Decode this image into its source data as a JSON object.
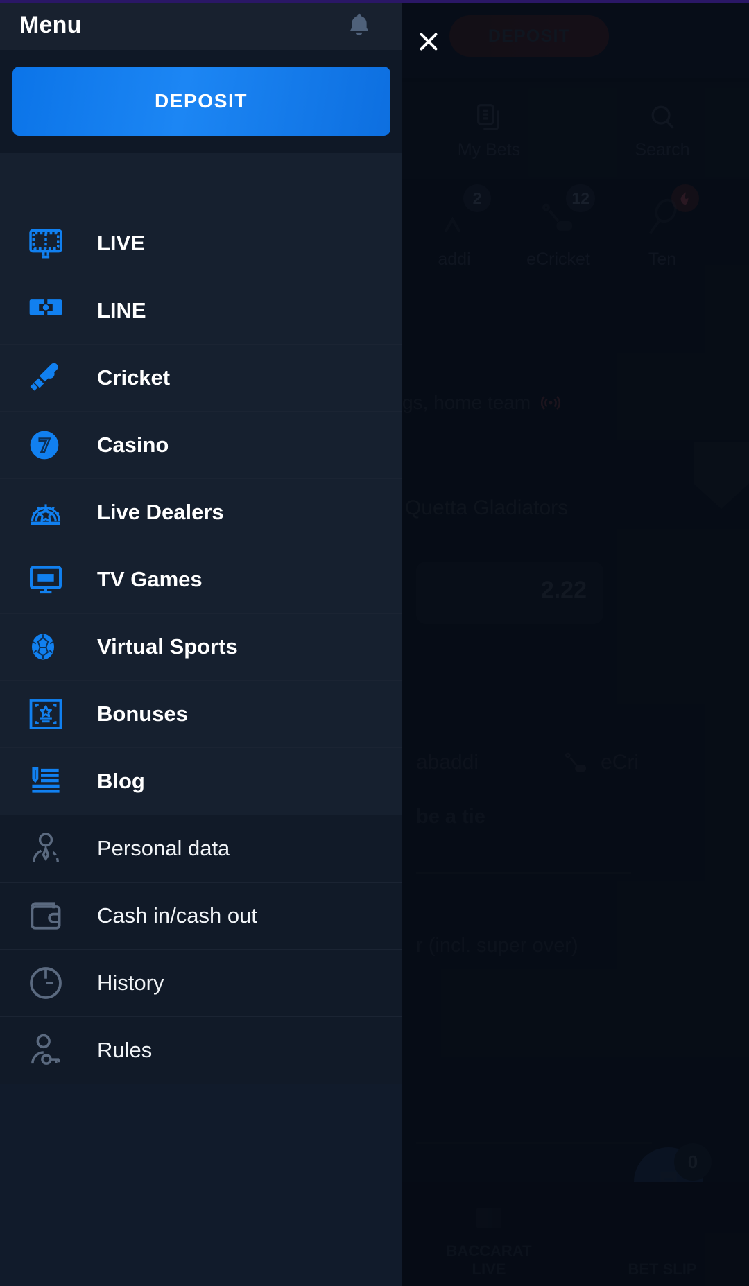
{
  "drawer": {
    "title": "Menu",
    "bell_icon": "bell-icon",
    "deposit_label": "DEPOSIT",
    "primary_items": [
      {
        "label": "LIVE",
        "icon": "live-scoreboard-icon"
      },
      {
        "label": "LINE",
        "icon": "line-field-icon"
      },
      {
        "label": "Cricket",
        "icon": "cricket-bat-ball-icon"
      },
      {
        "label": "Casino",
        "icon": "casino-seven-icon"
      },
      {
        "label": "Live Dealers",
        "icon": "roulette-star-icon"
      },
      {
        "label": "TV Games",
        "icon": "tv-monitor-icon"
      },
      {
        "label": "Virtual Sports",
        "icon": "football-icon"
      },
      {
        "label": "Bonuses",
        "icon": "bonus-gift-star-icon"
      },
      {
        "label": "Blog",
        "icon": "blog-list-icon"
      }
    ],
    "secondary_items": [
      {
        "label": "Personal data",
        "icon": "person-icon"
      },
      {
        "label": "Cash in/cash out",
        "icon": "wallet-icon"
      },
      {
        "label": "History",
        "icon": "history-clock-icon"
      },
      {
        "label": "Rules",
        "icon": "person-key-icon"
      }
    ]
  },
  "overlay": {
    "close_icon": "close-icon",
    "deposit_label": "DEPOSIT",
    "quick_nav": [
      {
        "label": "My Bets",
        "icon": "documents-icon"
      },
      {
        "label": "Search",
        "icon": "search-icon"
      }
    ],
    "sports": [
      {
        "label": "addi",
        "badge": "2",
        "icon": "kabaddi-icon",
        "hot": false
      },
      {
        "label": "eCricket",
        "badge": "12",
        "icon": "esports-icon",
        "hot": false
      },
      {
        "label": "Ten",
        "badge": "",
        "icon": "tennis-icon",
        "hot": true
      }
    ],
    "match": {
      "title": "gs, home team",
      "live_icon": "live-broadcast-icon",
      "team": "Quetta Gladiators",
      "odds": "2.22"
    },
    "row2": {
      "kabaddi": "abaddi",
      "ecricket": "eCri",
      "ecricket_icon": "esports-icon"
    },
    "tie_text": "be a tie",
    "super_over_text": "r (incl. super over)",
    "bottom_nav": [
      {
        "label": "BACCARAT\nLIVE",
        "icon": "cards-icon"
      },
      {
        "label": "BET SLIP",
        "icon": "betslip-icon"
      }
    ],
    "bet_slip_count": "0"
  },
  "colors": {
    "accent": "#1180f0",
    "drawer_bg": "#16202f",
    "header_bg": "#18212f",
    "text": "#ffffff"
  }
}
